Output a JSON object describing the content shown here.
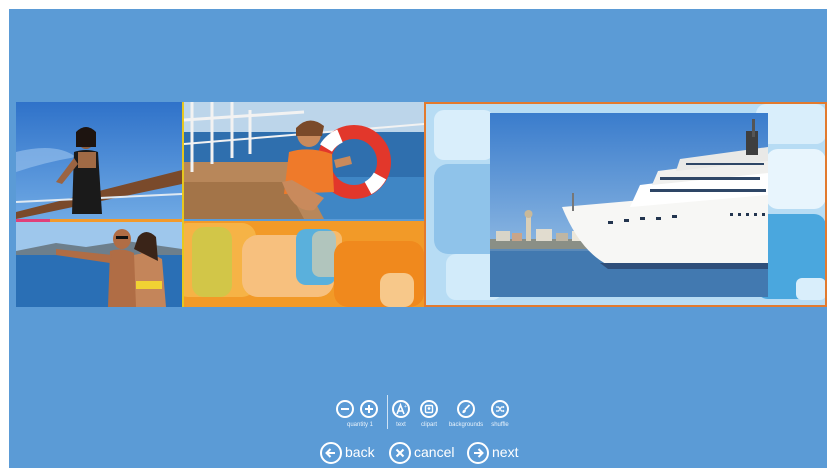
{
  "toolbar": {
    "quantity_label": "quantity 1",
    "text_label": "text",
    "clipart_label": "clipart",
    "backgrounds_label": "backgrounds",
    "shuffle_label": "shuffle"
  },
  "nav": {
    "back_label": "back",
    "cancel_label": "cancel",
    "next_label": "next"
  },
  "icons": {
    "remove": "minus-circle-icon",
    "add": "plus-circle-icon",
    "text": "text-size-icon",
    "clipart": "clipart-icon",
    "backgrounds": "paint-brush-icon",
    "shuffle": "shuffle-icon",
    "back": "arrow-left-icon",
    "cancel": "x-circle-icon",
    "next": "arrow-right-icon"
  },
  "colors": {
    "background": "#5b9bd6",
    "selected_border": "#e27a2e",
    "card_fill": "#b7dcf4",
    "collage_orange": "#f29a28"
  }
}
